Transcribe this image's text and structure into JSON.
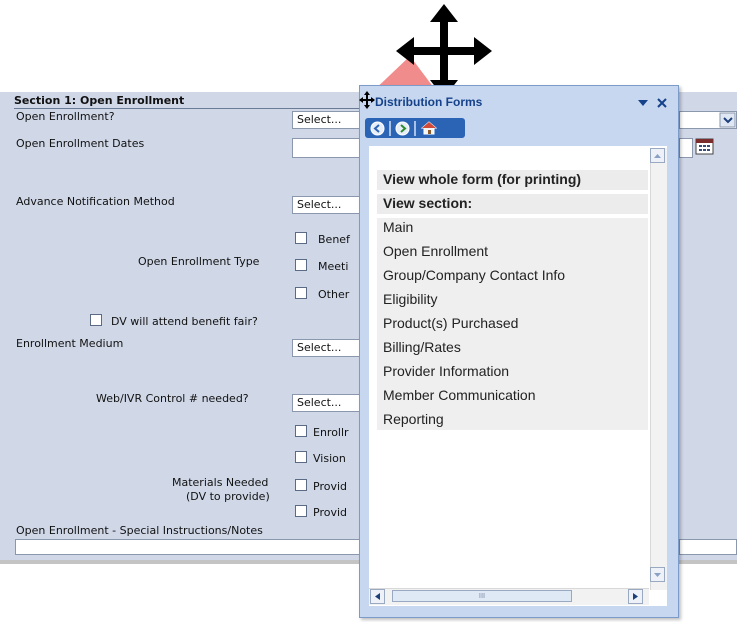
{
  "form": {
    "section_title": "Section 1: Open Enrollment",
    "open_enrollment_label": "Open Enrollment?",
    "open_enrollment_select": "Select...",
    "open_enrollment_dates_label": "Open Enrollment Dates",
    "advance_notification_label": "Advance Notification Method",
    "advance_notification_select": "Select...",
    "enrollment_type_label": "Open Enrollment Type",
    "enrollment_type_options": [
      "Benef",
      "Meeti",
      "Other"
    ],
    "dv_attend_label": "DV will attend benefit fair?",
    "enrollment_medium_label": "Enrollment Medium",
    "enrollment_medium_select": "Select...",
    "web_ivr_label": "Web/IVR Control # needed?",
    "web_ivr_select": "Select...",
    "materials_label_line1": "Materials Needed",
    "materials_label_line2": "(DV to provide)",
    "materials_options": [
      "Enrollr",
      "Vision",
      "Provid",
      "Provid"
    ],
    "notes_label": "Open Enrollment - Special Instructions/Notes"
  },
  "panel": {
    "title": "Distribution Forms",
    "heading_whole_form": "View whole form (for printing)",
    "heading_view_section": "View section:",
    "sections": [
      "Main",
      "Open Enrollment",
      "Group/Company Contact Info",
      "Eligibility",
      "Product(s) Purchased",
      "Billing/Rates",
      "Provider Information",
      "Member Communication",
      "Reporting"
    ],
    "scroll_thumb_marker": "III"
  },
  "colors": {
    "form_background": "#d0d8e8",
    "panel_background": "#c7d7ef",
    "panel_title": "#15428b",
    "toolbar": "#2b64b5",
    "drag_highlight": "#f08080"
  },
  "icons": {
    "move_cursor": "four-way-arrow",
    "back": "back-arrow-icon",
    "forward": "forward-arrow-icon",
    "home": "home-icon",
    "calendar": "calendar-icon"
  }
}
